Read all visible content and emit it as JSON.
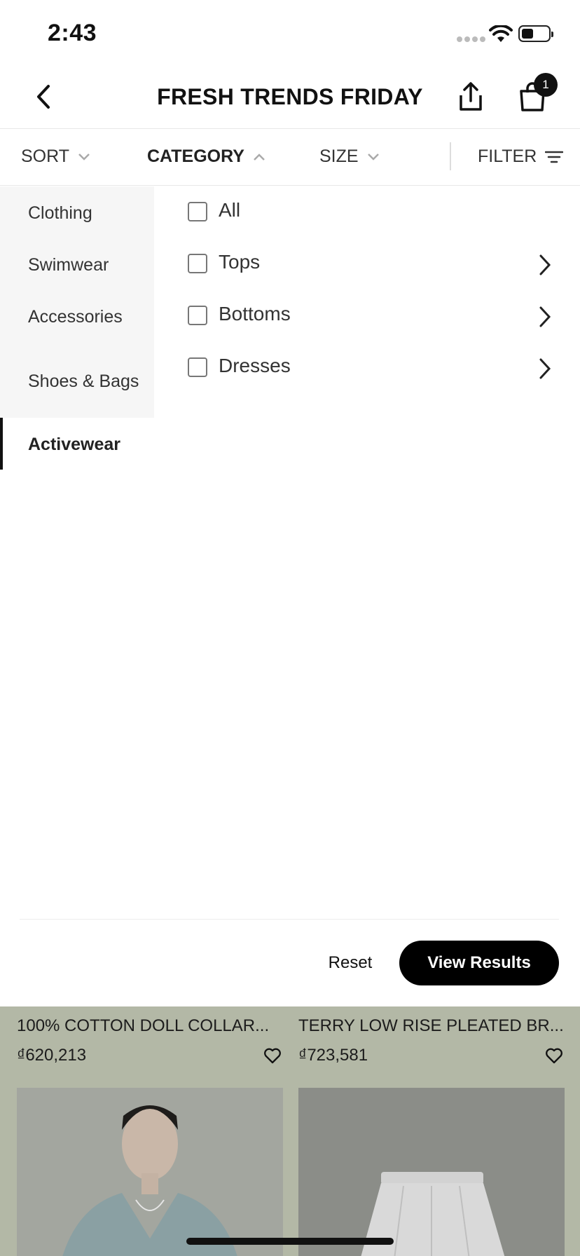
{
  "status_bar": {
    "time": "2:43"
  },
  "header": {
    "title": "FRESH TRENDS FRIDAY",
    "cart_count": "1"
  },
  "filter_bar": {
    "sort": "SORT",
    "category": "CATEGORY",
    "size": "SIZE",
    "filter": "FILTER"
  },
  "categories": {
    "left": [
      "Clothing",
      "Swimwear",
      "Accessories",
      "Shoes & Bags"
    ],
    "active": "Activewear",
    "options": [
      {
        "label": "All",
        "checked": false,
        "has_submenu": false
      },
      {
        "label": "Tops",
        "checked": false,
        "has_submenu": true
      },
      {
        "label": "Bottoms",
        "checked": false,
        "has_submenu": true
      },
      {
        "label": "Dresses",
        "checked": false,
        "has_submenu": true
      }
    ]
  },
  "footer": {
    "reset": "Reset",
    "view_results": "View Results"
  },
  "products": [
    {
      "name": "100% COTTON DOLL COLLAR...",
      "price": "₫620,213"
    },
    {
      "name": "TERRY LOW RISE PLEATED BR...",
      "price": "₫723,581"
    }
  ],
  "colors": {
    "accent": "#000000",
    "overlay": "#b3b8a6",
    "panel_bg": "#f6f6f6"
  }
}
